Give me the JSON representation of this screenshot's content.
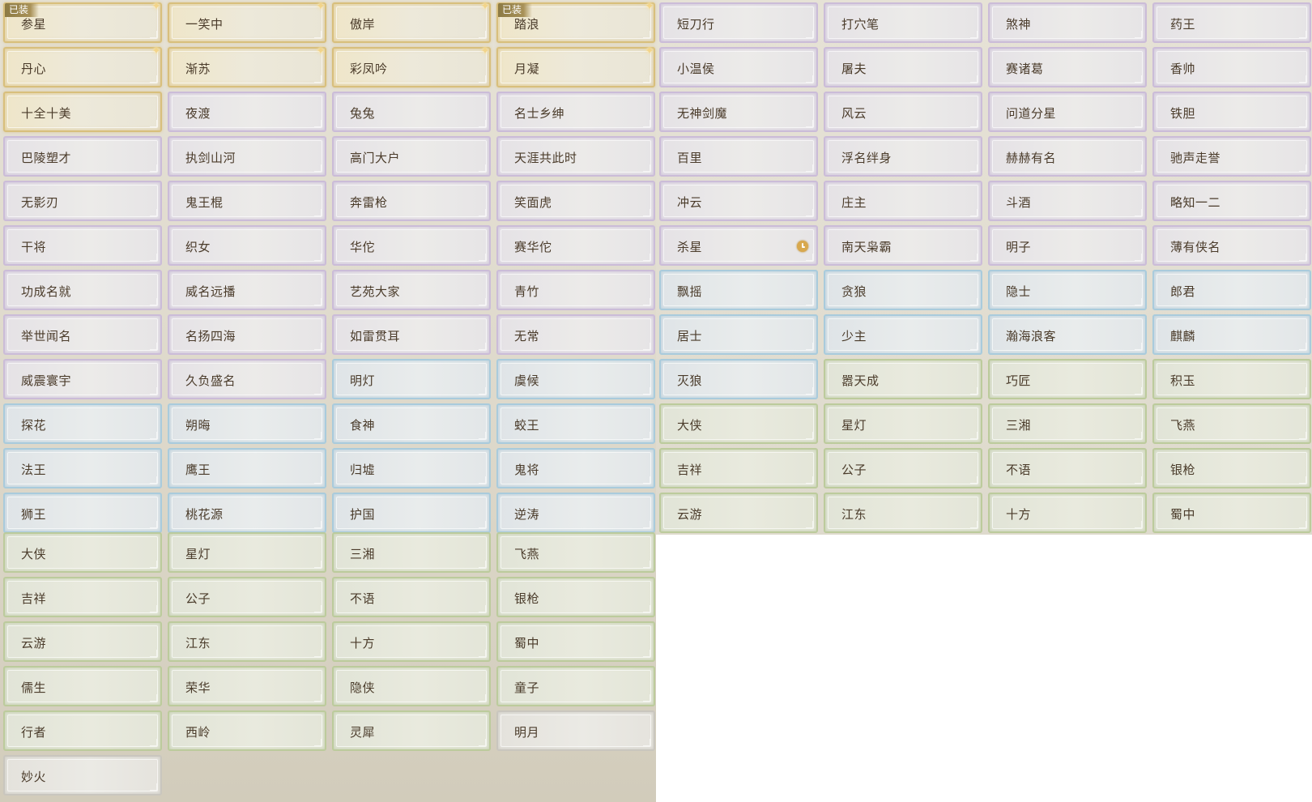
{
  "equipped_label": "已装",
  "colors": {
    "gold": "#d8bf7c",
    "purple": "#cbbcd8",
    "blue": "#a9cbdc",
    "green": "#bccb9c",
    "gray": "#c9c6be",
    "text": "#4a3b2a",
    "badge": "#8c7a44"
  },
  "rows": [
    [
      {
        "label": "参星",
        "rarity": "gold",
        "equipped": true,
        "star": true
      },
      {
        "label": "一笑中",
        "rarity": "gold",
        "star": true
      },
      {
        "label": "傲岸",
        "rarity": "gold",
        "star": true
      },
      {
        "label": "踏浪",
        "rarity": "gold",
        "equipped": true,
        "star": true
      },
      {
        "label": "短刀行",
        "rarity": "purple"
      },
      {
        "label": "打穴笔",
        "rarity": "purple"
      },
      {
        "label": "煞神",
        "rarity": "purple"
      },
      {
        "label": "药王",
        "rarity": "purple"
      }
    ],
    [
      {
        "label": "丹心",
        "rarity": "gold",
        "star": true
      },
      {
        "label": "渐苏",
        "rarity": "gold",
        "star": true
      },
      {
        "label": "彩凤吟",
        "rarity": "gold",
        "star": true
      },
      {
        "label": "月凝",
        "rarity": "gold",
        "star": true
      },
      {
        "label": "小温侯",
        "rarity": "purple"
      },
      {
        "label": "屠夫",
        "rarity": "purple"
      },
      {
        "label": "赛诸葛",
        "rarity": "purple"
      },
      {
        "label": "香帅",
        "rarity": "purple"
      }
    ],
    [
      {
        "label": "十全十美",
        "rarity": "gold"
      },
      {
        "label": "夜渡",
        "rarity": "purple"
      },
      {
        "label": "兔兔",
        "rarity": "purple"
      },
      {
        "label": "名士乡绅",
        "rarity": "purple"
      },
      {
        "label": "无神剑魔",
        "rarity": "purple"
      },
      {
        "label": "风云",
        "rarity": "purple"
      },
      {
        "label": "问道分星",
        "rarity": "purple"
      },
      {
        "label": "铁胆",
        "rarity": "purple"
      }
    ],
    [
      {
        "label": "巴陵塑才",
        "rarity": "purple"
      },
      {
        "label": "执剑山河",
        "rarity": "purple"
      },
      {
        "label": "高门大户",
        "rarity": "purple"
      },
      {
        "label": "天涯共此时",
        "rarity": "purple"
      },
      {
        "label": "百里",
        "rarity": "purple"
      },
      {
        "label": "浮名绊身",
        "rarity": "purple"
      },
      {
        "label": "赫赫有名",
        "rarity": "purple"
      },
      {
        "label": "驰声走誉",
        "rarity": "purple"
      }
    ],
    [
      {
        "label": "无影刃",
        "rarity": "purple"
      },
      {
        "label": "鬼王棍",
        "rarity": "purple"
      },
      {
        "label": "奔雷枪",
        "rarity": "purple"
      },
      {
        "label": "笑面虎",
        "rarity": "purple"
      },
      {
        "label": "冲云",
        "rarity": "purple"
      },
      {
        "label": "庄主",
        "rarity": "purple"
      },
      {
        "label": "斗酒",
        "rarity": "purple"
      },
      {
        "label": "略知一二",
        "rarity": "purple"
      }
    ],
    [
      {
        "label": "干将",
        "rarity": "purple"
      },
      {
        "label": "织女",
        "rarity": "purple"
      },
      {
        "label": "华佗",
        "rarity": "purple"
      },
      {
        "label": "赛华佗",
        "rarity": "purple"
      },
      {
        "label": "杀星",
        "rarity": "purple",
        "timed": true
      },
      {
        "label": "南天枭霸",
        "rarity": "purple"
      },
      {
        "label": "明子",
        "rarity": "purple"
      },
      {
        "label": "薄有侠名",
        "rarity": "purple"
      }
    ],
    [
      {
        "label": "功成名就",
        "rarity": "purple"
      },
      {
        "label": "威名远播",
        "rarity": "purple"
      },
      {
        "label": "艺苑大家",
        "rarity": "purple"
      },
      {
        "label": "青竹",
        "rarity": "purple"
      },
      {
        "label": "飘摇",
        "rarity": "blue"
      },
      {
        "label": "贪狼",
        "rarity": "blue"
      },
      {
        "label": "隐士",
        "rarity": "blue"
      },
      {
        "label": "郎君",
        "rarity": "blue"
      }
    ],
    [
      {
        "label": "举世闻名",
        "rarity": "purple"
      },
      {
        "label": "名扬四海",
        "rarity": "purple"
      },
      {
        "label": "如雷贯耳",
        "rarity": "purple"
      },
      {
        "label": "无常",
        "rarity": "purple"
      },
      {
        "label": "居士",
        "rarity": "blue"
      },
      {
        "label": "少主",
        "rarity": "blue"
      },
      {
        "label": "瀚海浪客",
        "rarity": "blue"
      },
      {
        "label": "麒麟",
        "rarity": "blue"
      }
    ],
    [
      {
        "label": "威震寰宇",
        "rarity": "purple"
      },
      {
        "label": "久负盛名",
        "rarity": "purple"
      },
      {
        "label": "明灯",
        "rarity": "blue"
      },
      {
        "label": "虞候",
        "rarity": "blue"
      },
      {
        "label": "灭狼",
        "rarity": "blue"
      },
      {
        "label": "嚣天成",
        "rarity": "green"
      },
      {
        "label": "巧匠",
        "rarity": "green"
      },
      {
        "label": "积玉",
        "rarity": "green"
      }
    ],
    [
      {
        "label": "探花",
        "rarity": "blue"
      },
      {
        "label": "朔晦",
        "rarity": "blue"
      },
      {
        "label": "食神",
        "rarity": "blue"
      },
      {
        "label": "蛟王",
        "rarity": "blue"
      },
      {
        "label": "大侠",
        "rarity": "green"
      },
      {
        "label": "星灯",
        "rarity": "green"
      },
      {
        "label": "三湘",
        "rarity": "green"
      },
      {
        "label": "飞燕",
        "rarity": "green"
      }
    ],
    [
      {
        "label": "法王",
        "rarity": "blue"
      },
      {
        "label": "鹰王",
        "rarity": "blue"
      },
      {
        "label": "归墟",
        "rarity": "blue"
      },
      {
        "label": "鬼将",
        "rarity": "blue"
      },
      {
        "label": "吉祥",
        "rarity": "green"
      },
      {
        "label": "公子",
        "rarity": "green"
      },
      {
        "label": "不语",
        "rarity": "green"
      },
      {
        "label": "银枪",
        "rarity": "green"
      }
    ],
    [
      {
        "label": "狮王",
        "rarity": "blue"
      },
      {
        "label": "桃花源",
        "rarity": "blue"
      },
      {
        "label": "护国",
        "rarity": "blue"
      },
      {
        "label": "逆涛",
        "rarity": "blue"
      },
      {
        "label": "云游",
        "rarity": "green"
      },
      {
        "label": "江东",
        "rarity": "green"
      },
      {
        "label": "十方",
        "rarity": "green"
      },
      {
        "label": "蜀中",
        "rarity": "green"
      }
    ],
    [
      {
        "label": "大侠",
        "rarity": "green"
      },
      {
        "label": "星灯",
        "rarity": "green"
      },
      {
        "label": "三湘",
        "rarity": "green"
      },
      {
        "label": "飞燕",
        "rarity": "green"
      }
    ],
    [
      {
        "label": "吉祥",
        "rarity": "green"
      },
      {
        "label": "公子",
        "rarity": "green"
      },
      {
        "label": "不语",
        "rarity": "green"
      },
      {
        "label": "银枪",
        "rarity": "green"
      }
    ],
    [
      {
        "label": "云游",
        "rarity": "green"
      },
      {
        "label": "江东",
        "rarity": "green"
      },
      {
        "label": "十方",
        "rarity": "green"
      },
      {
        "label": "蜀中",
        "rarity": "green"
      }
    ],
    [
      {
        "label": "儒生",
        "rarity": "green"
      },
      {
        "label": "荣华",
        "rarity": "green"
      },
      {
        "label": "隐侠",
        "rarity": "green"
      },
      {
        "label": "童子",
        "rarity": "green"
      }
    ],
    [
      {
        "label": "行者",
        "rarity": "green"
      },
      {
        "label": "西岭",
        "rarity": "green"
      },
      {
        "label": "灵犀",
        "rarity": "green"
      },
      {
        "label": "明月",
        "rarity": "gray"
      }
    ],
    [
      {
        "label": "妙火",
        "rarity": "gray"
      }
    ]
  ]
}
